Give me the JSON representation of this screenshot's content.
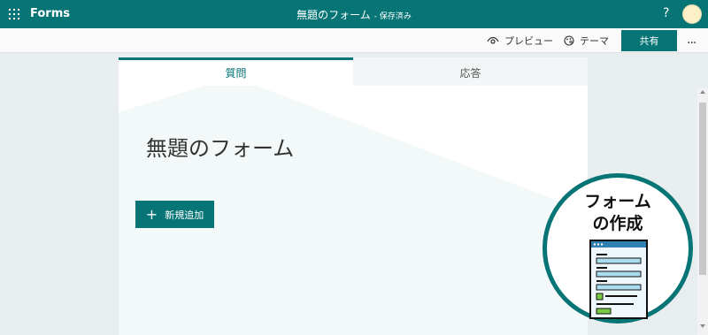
{
  "topbar": {
    "app_name": "Forms",
    "form_title": "無題のフォーム",
    "save_status": "- 保存済み",
    "help_label": "?"
  },
  "commandbar": {
    "preview_label": "プレビュー",
    "theme_label": "テーマ",
    "share_label": "共有",
    "more_label": "..."
  },
  "tabs": [
    {
      "label": "質問",
      "active": true
    },
    {
      "label": "応答",
      "active": false
    }
  ],
  "form": {
    "title": "無題のフォーム",
    "add_new_label": "新規追加"
  },
  "promo": {
    "line1": "フォーム",
    "line2": "の作成"
  },
  "colors": {
    "accent": "#077475",
    "background": "#e8eeef"
  }
}
